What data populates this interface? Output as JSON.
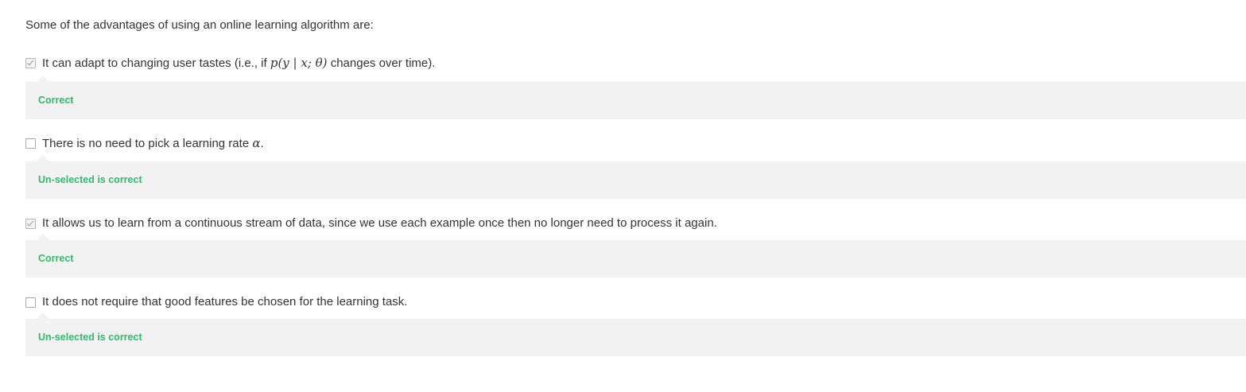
{
  "question": "Some of the advantages of using an online learning algorithm are:",
  "options": [
    {
      "checked": true,
      "text_before": "It can adapt to changing user tastes (i.e., if ",
      "math": "p(y | x; θ)",
      "text_after": " changes over time).",
      "feedback": "Correct"
    },
    {
      "checked": false,
      "text_before": "There is no need to pick a learning rate ",
      "math": "α",
      "text_after": ".",
      "feedback": "Un-selected is correct"
    },
    {
      "checked": true,
      "text_before": "It allows us to learn from a continuous stream of data, since we use each example once then no longer need to process it again.",
      "math": "",
      "text_after": "",
      "feedback": "Correct"
    },
    {
      "checked": false,
      "text_before": "It does not require that good features be chosen for the learning task.",
      "math": "",
      "text_after": "",
      "feedback": "Un-selected is correct"
    }
  ],
  "colors": {
    "feedback_text": "#2ebc6a",
    "feedback_bg": "#f2f2f2",
    "body_text": "#333333"
  }
}
